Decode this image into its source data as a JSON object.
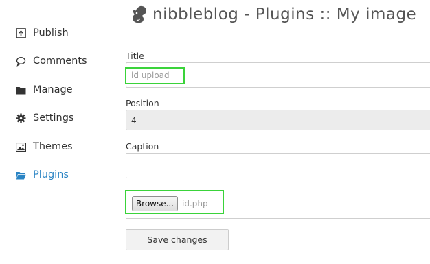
{
  "sidebar": {
    "items": [
      {
        "label": "Publish",
        "icon": "publish-icon"
      },
      {
        "label": "Comments",
        "icon": "comment-icon"
      },
      {
        "label": "Manage",
        "icon": "folder-icon"
      },
      {
        "label": "Settings",
        "icon": "gear-icon"
      },
      {
        "label": "Themes",
        "icon": "image-icon"
      },
      {
        "label": "Plugins",
        "icon": "folder-icon",
        "active": true
      }
    ]
  },
  "header": {
    "title": "nibbleblog - Plugins :: My image",
    "logo_icon": "squirrel-logo-icon"
  },
  "form": {
    "title_label": "Title",
    "title_value": "id upload",
    "position_label": "Position",
    "position_value": "4",
    "caption_label": "Caption",
    "caption_value": "",
    "browse_label": "Browse...",
    "file_name": "id.php",
    "save_label": "Save changes"
  },
  "colors": {
    "active_nav": "#2a84c4",
    "highlight": "#3ad33a",
    "text": "#333333"
  }
}
